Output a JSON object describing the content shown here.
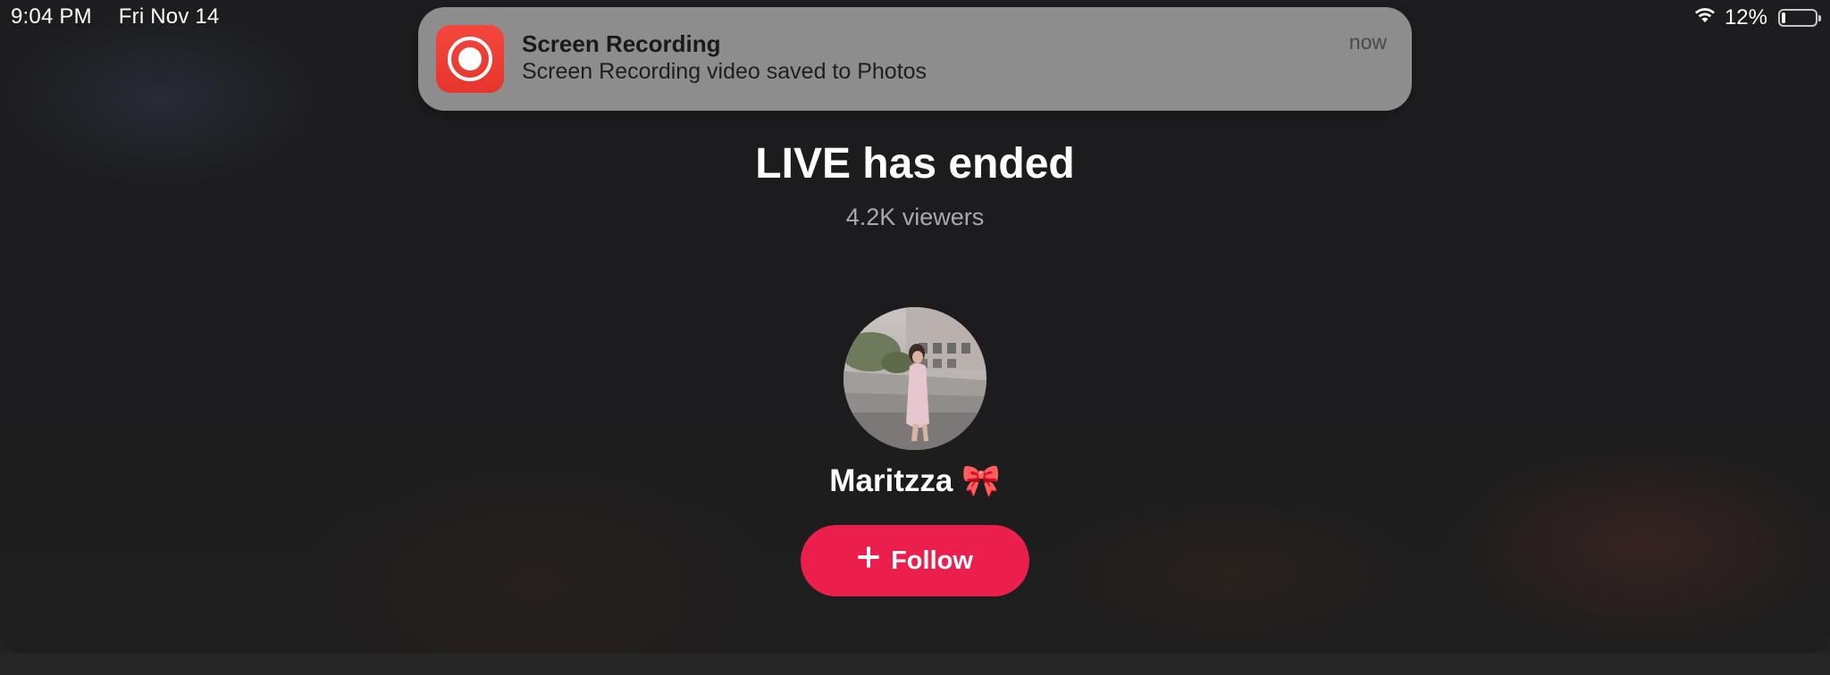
{
  "status_bar": {
    "time": "9:04 PM",
    "date": "Fri Nov 14",
    "battery_percent_label": "12%",
    "battery_level": 0.12,
    "icons": [
      "wifi-icon",
      "battery-icon"
    ]
  },
  "notification": {
    "app_icon": "screen-recording-icon",
    "title": "Screen Recording",
    "body": "Screen Recording video saved to Photos",
    "time": "now"
  },
  "live": {
    "title": "LIVE has ended",
    "viewers": "4.2K viewers"
  },
  "profile": {
    "avatar": "profile-photo",
    "name": "Maritzza 🎀"
  },
  "follow_button": {
    "icon": "plus-icon",
    "label": "Follow"
  },
  "colors": {
    "accent": "#ec1f4c",
    "notification_icon": "#f13f36",
    "background": "#1d1d1f"
  }
}
